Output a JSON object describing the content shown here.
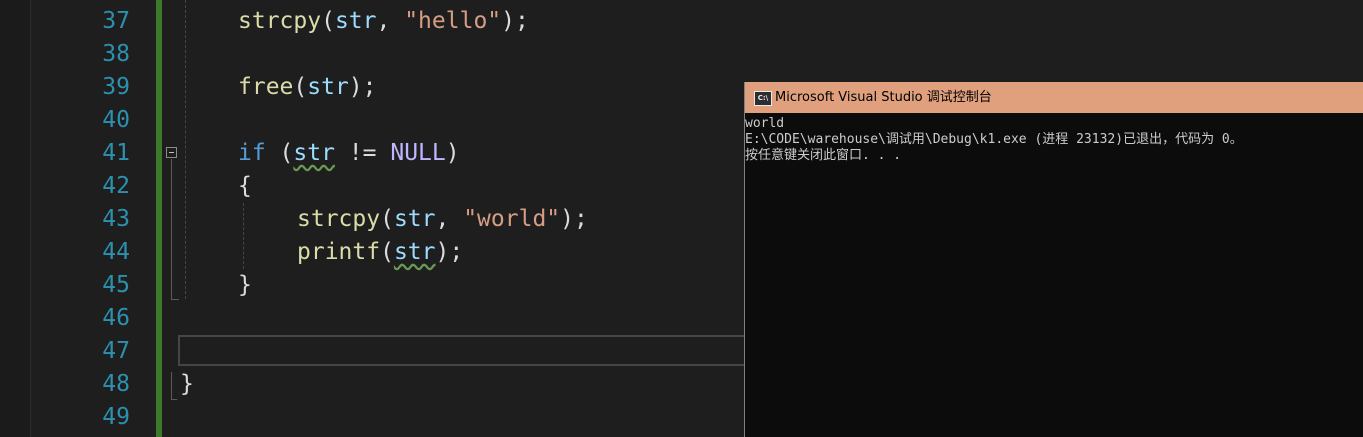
{
  "editor": {
    "lines": [
      {
        "number": "37"
      },
      {
        "number": "38"
      },
      {
        "number": "39"
      },
      {
        "number": "40"
      },
      {
        "number": "41"
      },
      {
        "number": "42"
      },
      {
        "number": "43"
      },
      {
        "number": "44"
      },
      {
        "number": "45"
      },
      {
        "number": "46"
      },
      {
        "number": "47"
      },
      {
        "number": "48"
      },
      {
        "number": "49"
      }
    ],
    "code": {
      "l37": {
        "fn": "strcpy",
        "open": "(",
        "arg": "str",
        "comma": ", ",
        "str": "\"hello\"",
        "close": ");"
      },
      "l39": {
        "fn": "free",
        "open": "(",
        "arg": "str",
        "close": ");"
      },
      "l41": {
        "kw": "if",
        "open": " (",
        "arg": "str",
        "op": " != ",
        "macro": "NULL",
        "close": ")"
      },
      "l42": {
        "brace": "{"
      },
      "l43": {
        "fn": "strcpy",
        "open": "(",
        "arg": "str",
        "comma": ", ",
        "str": "\"world\"",
        "close": ");"
      },
      "l44": {
        "fn": "printf",
        "open": "(",
        "arg": "str",
        "close": ");"
      },
      "l45": {
        "brace": "}"
      },
      "l48": {
        "brace": "}"
      }
    },
    "colors": {
      "line_number": "#2b91af",
      "function": "#dcdcaa",
      "variable": "#9cdcfe",
      "string": "#d69d85",
      "keyword": "#569cd6",
      "macro": "#beb7ff",
      "change_bar": "#3b7a2a"
    }
  },
  "console": {
    "icon_label": "C:\\",
    "title": "Microsoft Visual Studio 调试控制台",
    "output": [
      "world",
      "E:\\CODE\\warehouse\\调试用\\Debug\\k1.exe (进程 23132)已退出，代码为 0。",
      "按任意键关闭此窗口. . ."
    ],
    "colors": {
      "titlebar": "#e0a07e",
      "background": "#0c0c0c",
      "text": "#cccccc"
    }
  }
}
